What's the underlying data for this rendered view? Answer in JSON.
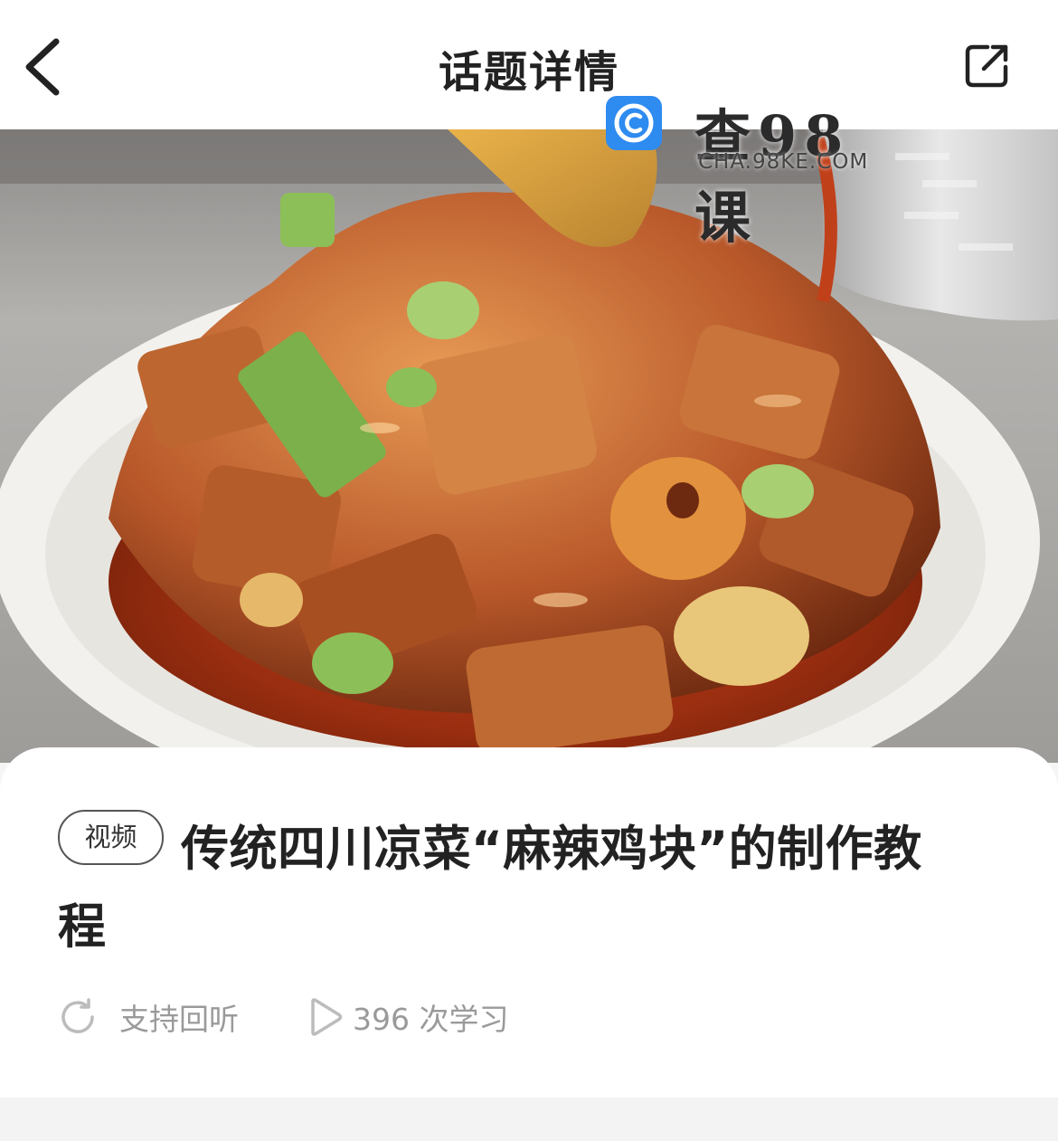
{
  "header": {
    "title": "话题详情",
    "back_icon": "chevron-left-icon",
    "share_icon": "external-share-icon"
  },
  "watermark": {
    "brand_cn": "查98课",
    "brand_url": "CHA.98KE.COM",
    "logo_color": "#2e8bf0"
  },
  "cover": {
    "subject": "麻辣鸡块"
  },
  "topic": {
    "tag": "视频",
    "title_line1": "传统四川凉菜“麻辣鸡块”的制作教",
    "title_line2": "程"
  },
  "meta": {
    "replay_icon": "replay-icon",
    "replay_label": "支持回听",
    "views_icon": "play-icon",
    "views_label": "396 次学习"
  },
  "colors": {
    "text_primary": "#222222",
    "text_secondary": "#9a9a9a",
    "background": "#f5f5f5"
  }
}
